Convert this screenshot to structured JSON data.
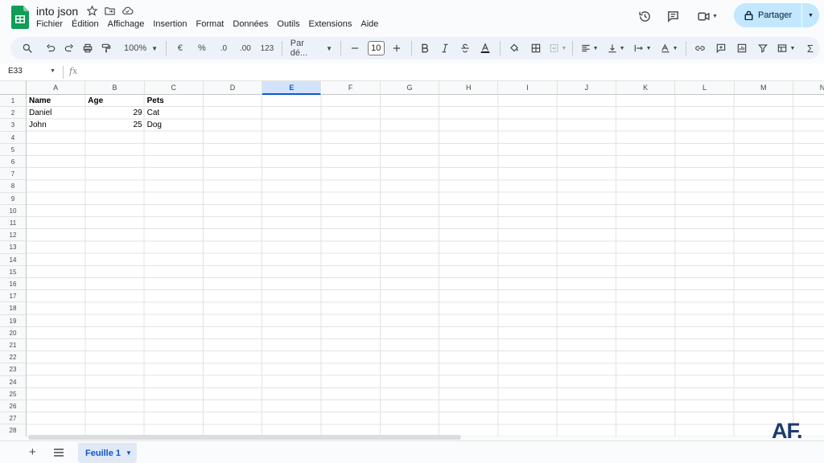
{
  "document": {
    "title": "into json"
  },
  "menu": [
    "Fichier",
    "Édition",
    "Affichage",
    "Insertion",
    "Format",
    "Données",
    "Outils",
    "Extensions",
    "Aide"
  ],
  "share": {
    "label": "Partager"
  },
  "toolbar": {
    "zoom": "100%",
    "currency": "€",
    "percent": "%",
    "dec_minus": ".0",
    "dec_plus": ".00",
    "number_format": "123",
    "font": "Par dé...",
    "font_size": "10",
    "sigma": "Σ"
  },
  "formula_bar": {
    "cell_ref": "E33",
    "fx": "fx",
    "value": ""
  },
  "grid": {
    "columns": [
      "A",
      "B",
      "C",
      "D",
      "E",
      "F",
      "G",
      "H",
      "I",
      "J",
      "K",
      "L",
      "M",
      "N"
    ],
    "selected_column": "E",
    "row_count": 28,
    "rows": [
      [
        "Name",
        "Age",
        "Pets"
      ],
      [
        "Daniel",
        "29",
        "Cat"
      ],
      [
        "John",
        "25",
        "Dog"
      ]
    ]
  },
  "sheets": {
    "active": "Feuille 1"
  },
  "watermark": "AF.",
  "colors": {
    "accent": "#0b57d0",
    "share_bg": "#c2e7ff",
    "toolbar_bg": "#edf2fa",
    "logo": "#0f9d58"
  }
}
